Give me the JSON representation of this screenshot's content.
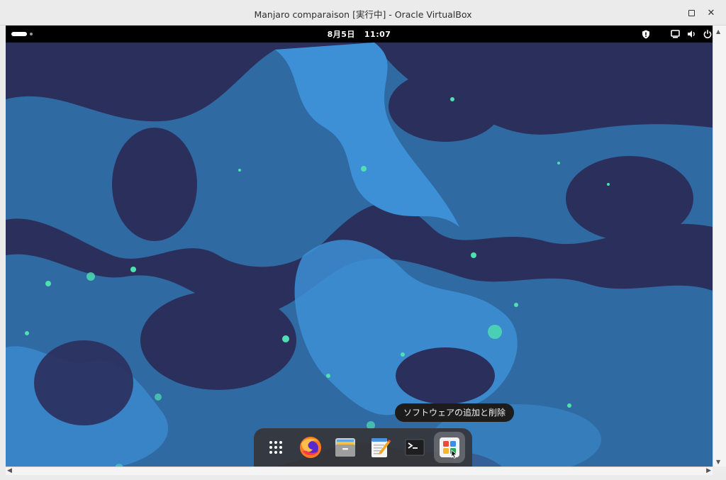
{
  "window": {
    "title": "Manjaro comparaison [実行中] - Oracle VirtualBox",
    "maximize_icon": "maximize-icon",
    "close_icon": "close-icon",
    "close_glyph": "✕"
  },
  "topbar": {
    "activities_icon": "activities-indicator-icon",
    "date": "8月5日",
    "time": "11:07",
    "tray_icons": [
      "shield-icon",
      "display-icon",
      "volume-icon",
      "power-icon"
    ]
  },
  "dock": {
    "tooltip": "ソフトウェアの追加と削除",
    "items": [
      {
        "name": "app-grid",
        "icon": "grid-icon"
      },
      {
        "name": "firefox",
        "icon": "firefox-icon"
      },
      {
        "name": "files",
        "icon": "file-cabinet-icon"
      },
      {
        "name": "text-editor",
        "icon": "notepad-icon"
      },
      {
        "name": "terminal",
        "icon": "terminal-icon"
      },
      {
        "name": "software",
        "icon": "software-store-icon",
        "active": true
      }
    ]
  },
  "colors": {
    "wallpaper_dark": "#2b2f5c",
    "wallpaper_mid": "#2f6aa3",
    "wallpaper_light": "#3d8fd6",
    "glow": "#4fe0b0",
    "topbar": "#000000",
    "dock": "#36363a"
  }
}
